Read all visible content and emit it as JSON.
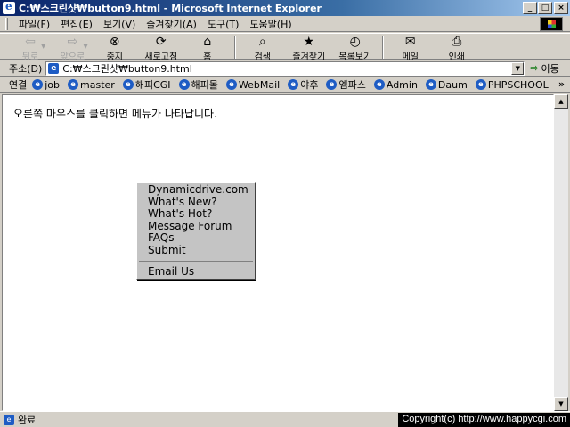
{
  "window": {
    "title": "C:₩스크린샷₩button9.html - Microsoft Internet Explorer",
    "min_label": "_",
    "max_label": "□",
    "close_label": "×"
  },
  "menubar": {
    "items": [
      "파일(F)",
      "편집(E)",
      "보기(V)",
      "즐겨찾기(A)",
      "도구(T)",
      "도움말(H)"
    ]
  },
  "toolbar": {
    "back": "뒤로",
    "forward": "앞으로",
    "stop": "중지",
    "refresh": "새로고침",
    "home": "홈",
    "search": "검색",
    "favorites": "즐겨찾기",
    "history": "목록보기",
    "mail": "메일",
    "print": "인쇄"
  },
  "address": {
    "label": "주소(D)",
    "value": "C:₩스크린샷₩button9.html",
    "go_label": "이동"
  },
  "links": {
    "label": "연결",
    "items": [
      "job",
      "master",
      "해피CGI",
      "해피몰",
      "WebMail",
      "야후",
      "엠파스",
      "Admin",
      "Daum",
      "PHPSCHOOL"
    ],
    "more": "»"
  },
  "page": {
    "text": "오른쪽 마우스를 클릭하면 메뉴가 나타납니다."
  },
  "context_menu": {
    "items": [
      "Dynamicdrive.com",
      "What's New?",
      "What's Hot?",
      "Message Forum",
      "FAQs",
      "Submit"
    ],
    "extra_items": [
      "Email Us"
    ]
  },
  "status": {
    "text": "완료",
    "copyright": "Copyright(c) http://www.happycgi.com"
  },
  "colors": {
    "titlebar_start": "#0a246a",
    "chrome": "#d4d0c8",
    "menu_bg": "#c4c4c4"
  }
}
